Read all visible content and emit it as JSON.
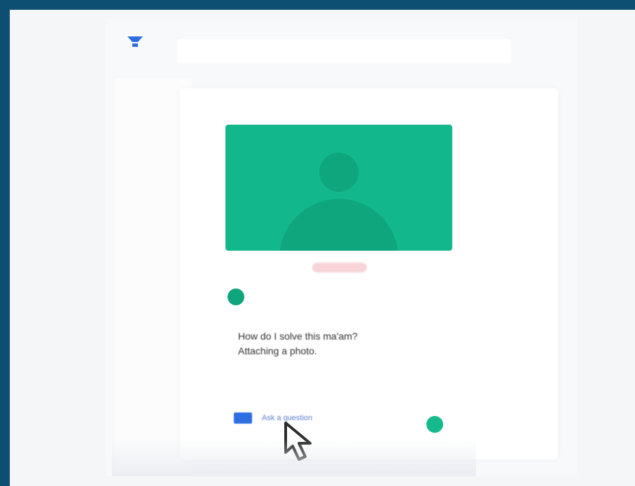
{
  "post": {
    "question_line_1": "How do I solve this ma'am?",
    "question_line_2": "Attaching a photo.",
    "footer_label": "Ask a question"
  },
  "colors": {
    "background": "#0d4f73",
    "surface": "#ffffff",
    "accent_green": "#12b88b",
    "accent_blue": "#2d6fe0",
    "text": "#333333"
  },
  "icons": {
    "logo": "funnel-logo",
    "avatar": "user-silhouette",
    "cursor": "mouse-pointer"
  }
}
